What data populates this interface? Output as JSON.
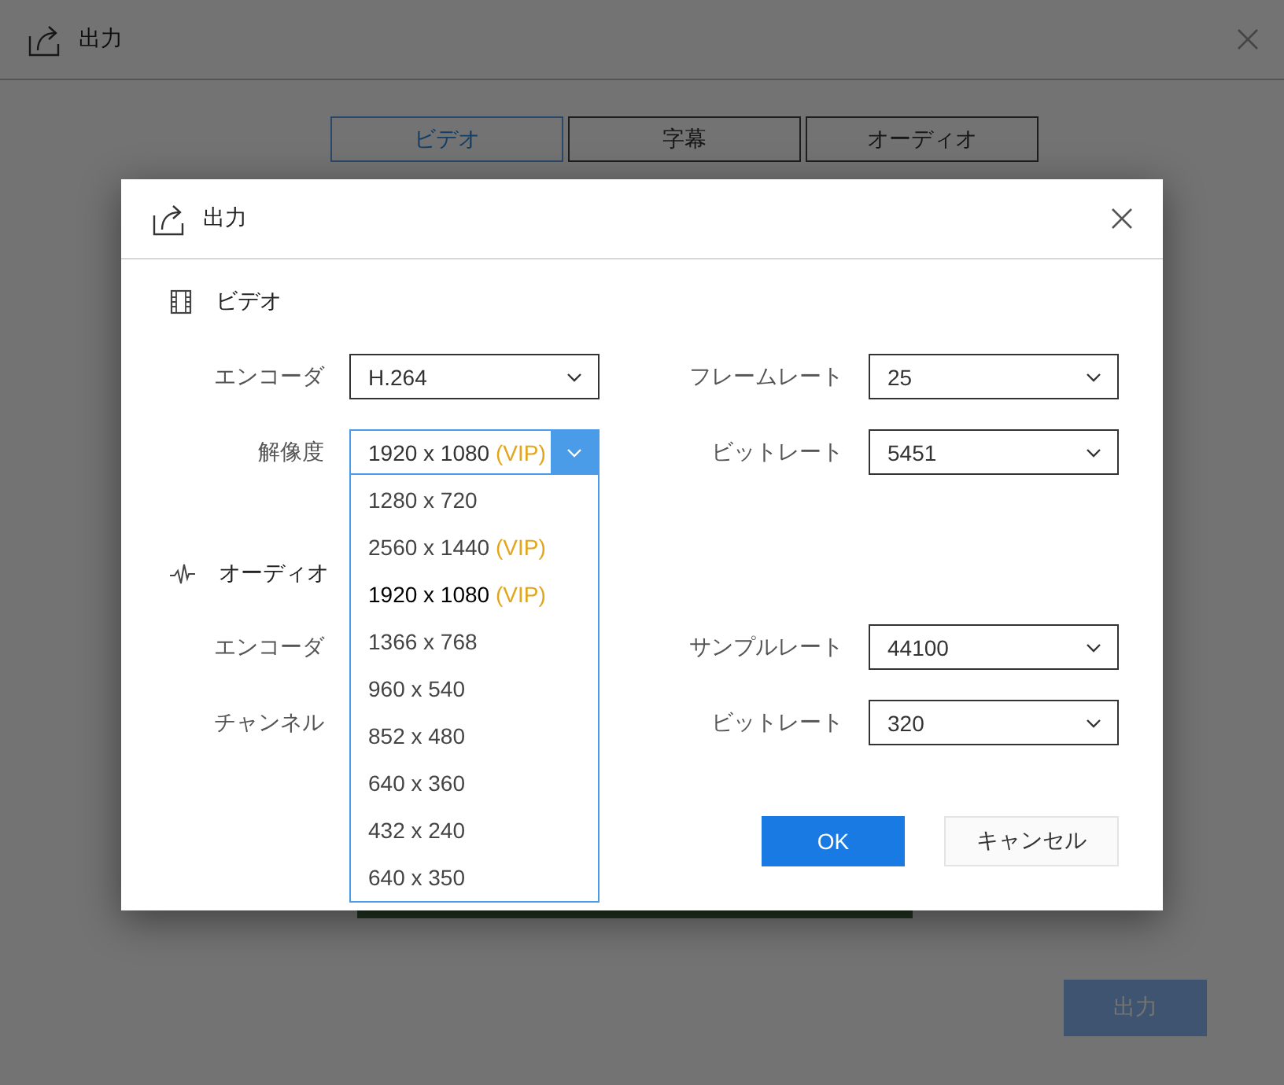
{
  "window": {
    "title": "出力"
  },
  "tabs": [
    {
      "label": "ビデオ",
      "selected": true
    },
    {
      "label": "字幕",
      "selected": false
    },
    {
      "label": "オーディオ",
      "selected": false
    }
  ],
  "export_button": "出力",
  "dialog": {
    "title": "出力",
    "sections": [
      {
        "kind": "video",
        "title": "ビデオ",
        "fields": [
          {
            "label": "エンコーダ",
            "value": "H.264",
            "open": false
          },
          {
            "label": "フレームレート",
            "value": "25",
            "open": false
          },
          {
            "label": "解像度",
            "value": "1920 x 1080",
            "tag": "(VIP)",
            "open": true,
            "options": [
              {
                "text": "1280 x 720",
                "selected": false
              },
              {
                "text": "2560 x 1440",
                "tag": "(VIP)",
                "selected": false
              },
              {
                "text": "1920 x 1080",
                "tag": "(VIP)",
                "selected": true
              },
              {
                "text": "1366 x 768",
                "selected": false
              },
              {
                "text": "960 x 540",
                "selected": false
              },
              {
                "text": "852 x 480",
                "selected": false
              },
              {
                "text": "640 x 360",
                "selected": false
              },
              {
                "text": "432 x 240",
                "selected": false
              },
              {
                "text": "640 x 350",
                "selected": false
              }
            ]
          },
          {
            "label": "ビットレート",
            "value": "5451",
            "open": false
          }
        ]
      },
      {
        "kind": "audio",
        "title": "オーディオ",
        "fields": [
          {
            "label": "エンコーダ"
          },
          {
            "label": "サンプルレート",
            "value": "44100",
            "open": false
          },
          {
            "label": "チャンネル"
          },
          {
            "label": "ビットレート",
            "value": "320",
            "open": false
          }
        ]
      }
    ],
    "buttons": [
      {
        "label": "OK",
        "kind": "primary"
      },
      {
        "label": "キャンセル",
        "kind": "secondary"
      }
    ]
  }
}
